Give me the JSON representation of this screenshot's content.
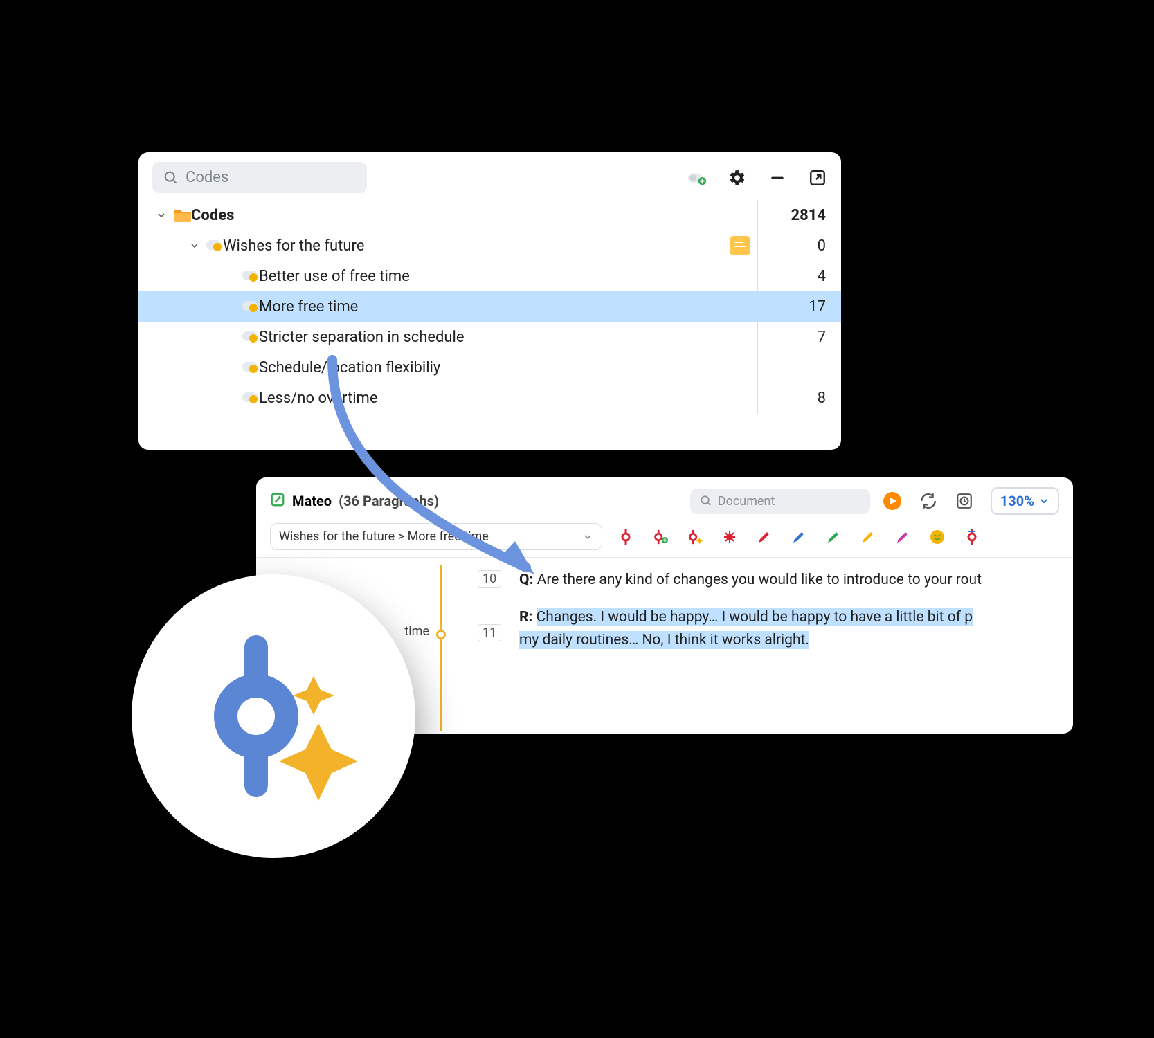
{
  "codes_panel": {
    "search_placeholder": "Codes",
    "root_label": "Codes",
    "root_count": "2814",
    "group_label": "Wishes for the future",
    "group_count": "0",
    "items": [
      {
        "label": "Better use of free time",
        "count": "4"
      },
      {
        "label": "More free time",
        "count": "17"
      },
      {
        "label": "Stricter separation in schedule",
        "count": "7"
      },
      {
        "label": "Schedule/location flexibiliy",
        "count": ""
      },
      {
        "label": "Less/no overtime",
        "count": "8"
      }
    ],
    "selected_index": 1
  },
  "doc_panel": {
    "doc_name": "Mateo",
    "doc_meta": "(36 Paragraphs)",
    "search_placeholder": "Document",
    "zoom": "130%",
    "breadcrumb": "Wishes for the future > More free time",
    "margin_label": "time",
    "para10_num": "10",
    "para11_num": "11",
    "q_speaker": "Q:",
    "q_text": "Are there any kind of changes you would like to introduce to your rout",
    "r_speaker": "R:",
    "r_hl_line1": "Changes. I would be happy… I would be happy to have a little bit of p",
    "r_hl_line2": "my daily routines… No, I think it works alright."
  }
}
